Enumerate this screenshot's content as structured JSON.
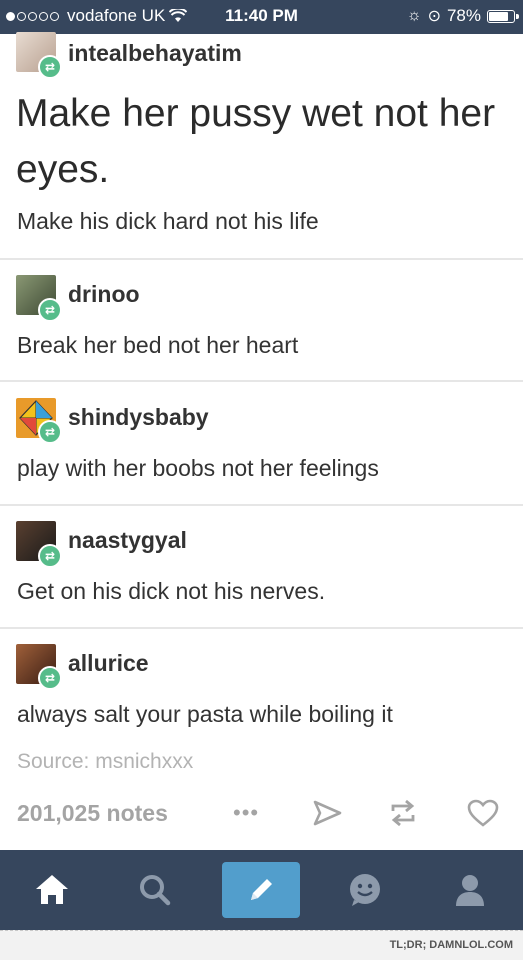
{
  "status_bar": {
    "carrier": "vodafone UK",
    "time": "11:40 PM",
    "battery": "78%",
    "battery_level": 0.78,
    "signal_bars_filled": 1,
    "signal_bars_total": 5
  },
  "posts": [
    {
      "username": "intealbehayatim",
      "headline": "Make her pussy wet not her eyes.",
      "text": "Make his dick hard not his life",
      "avatar_color": "#c9b7a8"
    },
    {
      "username": "drinoo",
      "text": "Break her bed not her heart",
      "avatar_color": "#5d6b4e"
    },
    {
      "username": "shindysbaby",
      "text": "play with her boobs not her feelings",
      "avatar_color": "#e89a2a"
    },
    {
      "username": "naastygyal",
      "text": "Get on his dick not his nerves.",
      "avatar_color": "#2a2a2a"
    },
    {
      "username": "allurice",
      "text": "always salt your pasta while boiling it",
      "avatar_color": "#6b3b2a"
    }
  ],
  "source": "Source: msnichxxx",
  "footer": {
    "notes": "201,025 notes",
    "more": "•••",
    "icons": [
      "share-icon",
      "reblog-icon",
      "like-icon"
    ]
  },
  "tabbar": {
    "icons": [
      "home-icon",
      "search-icon",
      "compose-icon",
      "messages-icon",
      "account-icon"
    ]
  },
  "watermark": "TL;DR; DAMNLOL.COM",
  "colors": {
    "header": "#36465d",
    "reblog_green": "#56bc8a",
    "compose_blue": "#529ecc",
    "muted": "#a4a4a4"
  }
}
